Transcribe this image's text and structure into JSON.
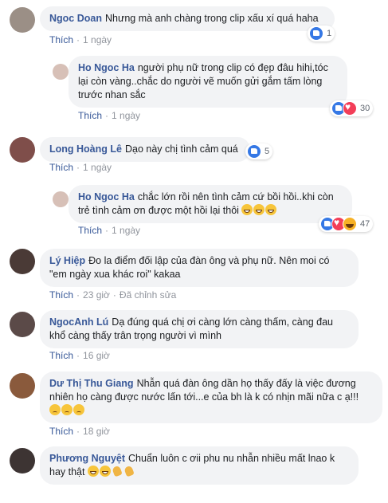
{
  "labels": {
    "like": "Thích",
    "edited": "Đã chỉnh sửa"
  },
  "comments": [
    {
      "name": "Ngoc Doan",
      "text": "Nhưng mà anh chàng trong clip xấu xí quá haha",
      "time": "1 ngày",
      "reaction_count": "1",
      "reactions": [
        "like"
      ]
    },
    {
      "name": "Ho Ngoc Ha",
      "text": "người phụ nữ trong clip có đẹp đâu hihi,tóc lại còn vàng..chắc do người vẽ muốn gửi gắm tấm lòng trước nhan sắc",
      "time": "1 ngày",
      "reaction_count": "30",
      "reactions": [
        "like",
        "love"
      ]
    },
    {
      "name": "Long Hoàng Lê",
      "text": "Dạo này chị tình cảm quá",
      "time": "1 ngày",
      "reaction_count": "5",
      "reactions": [
        "like"
      ]
    },
    {
      "name": "Ho Ngoc Ha",
      "text": "chắc lớn rồi nên tình cảm cứ bồi hồi..khi còn trẻ tình cảm ơn được một hồi lại thôi",
      "emojis": [
        "grin-emoji",
        "grin-emoji",
        "grin-emoji"
      ],
      "time": "1 ngày",
      "reaction_count": "47",
      "reactions": [
        "like",
        "love",
        "haha"
      ]
    },
    {
      "name": "Lý Hiệp",
      "text": "Đo la điểm đối lập của đàn ông và phụ nữ. Nên moi có \"em ngày xua khác roi\" kakaa",
      "time": "23 giờ"
    },
    {
      "name": "NgocAnh Lú",
      "text": "Dạ đúng quá chị ơi càng lớn càng thấm, càng đau khổ càng thấy trân trọng người vì mình",
      "time": "16 giờ"
    },
    {
      "name": "Dư Thị Thu Giang",
      "text": "Nhẫn quá đàn ông dần họ thấy đấy là việc đương nhiên họ càng được nước lấn tới...e của bh là k có nhịn mãi nữa c ạ!!!",
      "emojis": [
        "sad-emoji",
        "sad-emoji",
        "sad-emoji"
      ],
      "time": "18 giờ"
    },
    {
      "name": "Phương Nguyệt",
      "text": "Chuẩn luôn c ơii phu nu nhẫn nhiều mất lnao k hay thật",
      "emojis": [
        "grin-emoji",
        "grin-emoji",
        "clap-emoji",
        "clap-emoji"
      ],
      "time": ""
    }
  ]
}
